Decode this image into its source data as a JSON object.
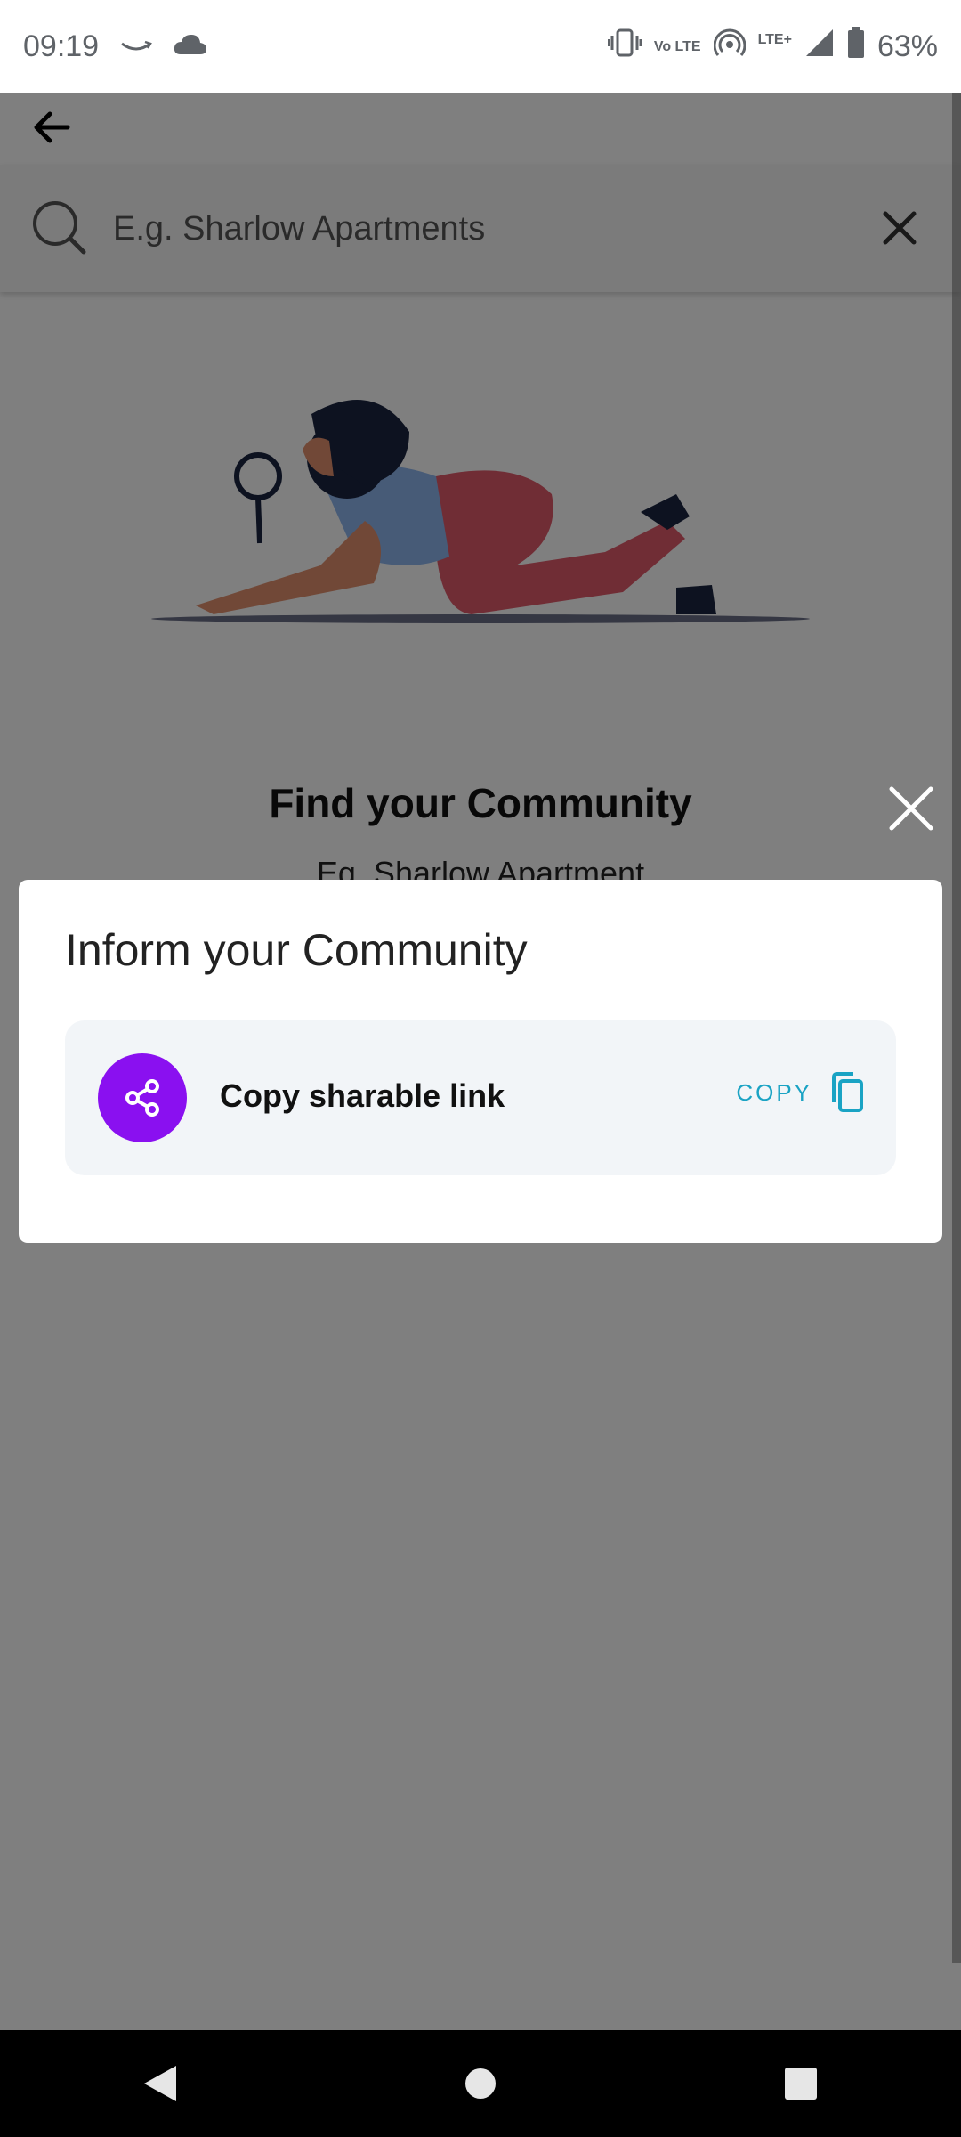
{
  "status_bar": {
    "time": "09:19",
    "battery": "63%",
    "network": "LTE+",
    "volte": "Vo LTE",
    "icons": [
      "amazon-smile-icon",
      "cloud-icon",
      "vibrate-icon",
      "volte-icon",
      "hotspot-icon",
      "signal-icon",
      "battery-icon"
    ]
  },
  "search": {
    "placeholder": "E.g. Sharlow Apartments"
  },
  "page": {
    "title": "Find your Community",
    "subtitle": "Eg. Sharlow Apartment"
  },
  "sheet": {
    "title": "Inform your Community",
    "share_label": "Copy sharable link",
    "copy_label": "COPY"
  },
  "colors": {
    "share_accent": "#8a10f0",
    "copy_accent": "#1aa3c4"
  }
}
